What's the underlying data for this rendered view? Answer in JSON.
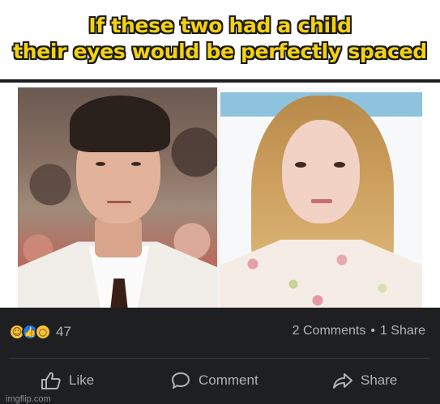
{
  "caption": {
    "line1": "If these two had a child",
    "line2": "their eyes would be perfectly spaced"
  },
  "post": {
    "reactions": {
      "icons": [
        "laugh-icon",
        "like-icon",
        "wow-icon"
      ],
      "count": "47"
    },
    "comments": "2 Comments",
    "separator": "•",
    "shares": "1 Share",
    "actions": {
      "like": "Like",
      "comment": "Comment",
      "share": "Share"
    }
  },
  "watermark": "imgflip.com",
  "colors": {
    "caption_fill": "#f4d20f",
    "caption_outline": "#1b1b1b",
    "bar_background": "#1e1f21",
    "bar_text": "#b0b3b8"
  }
}
